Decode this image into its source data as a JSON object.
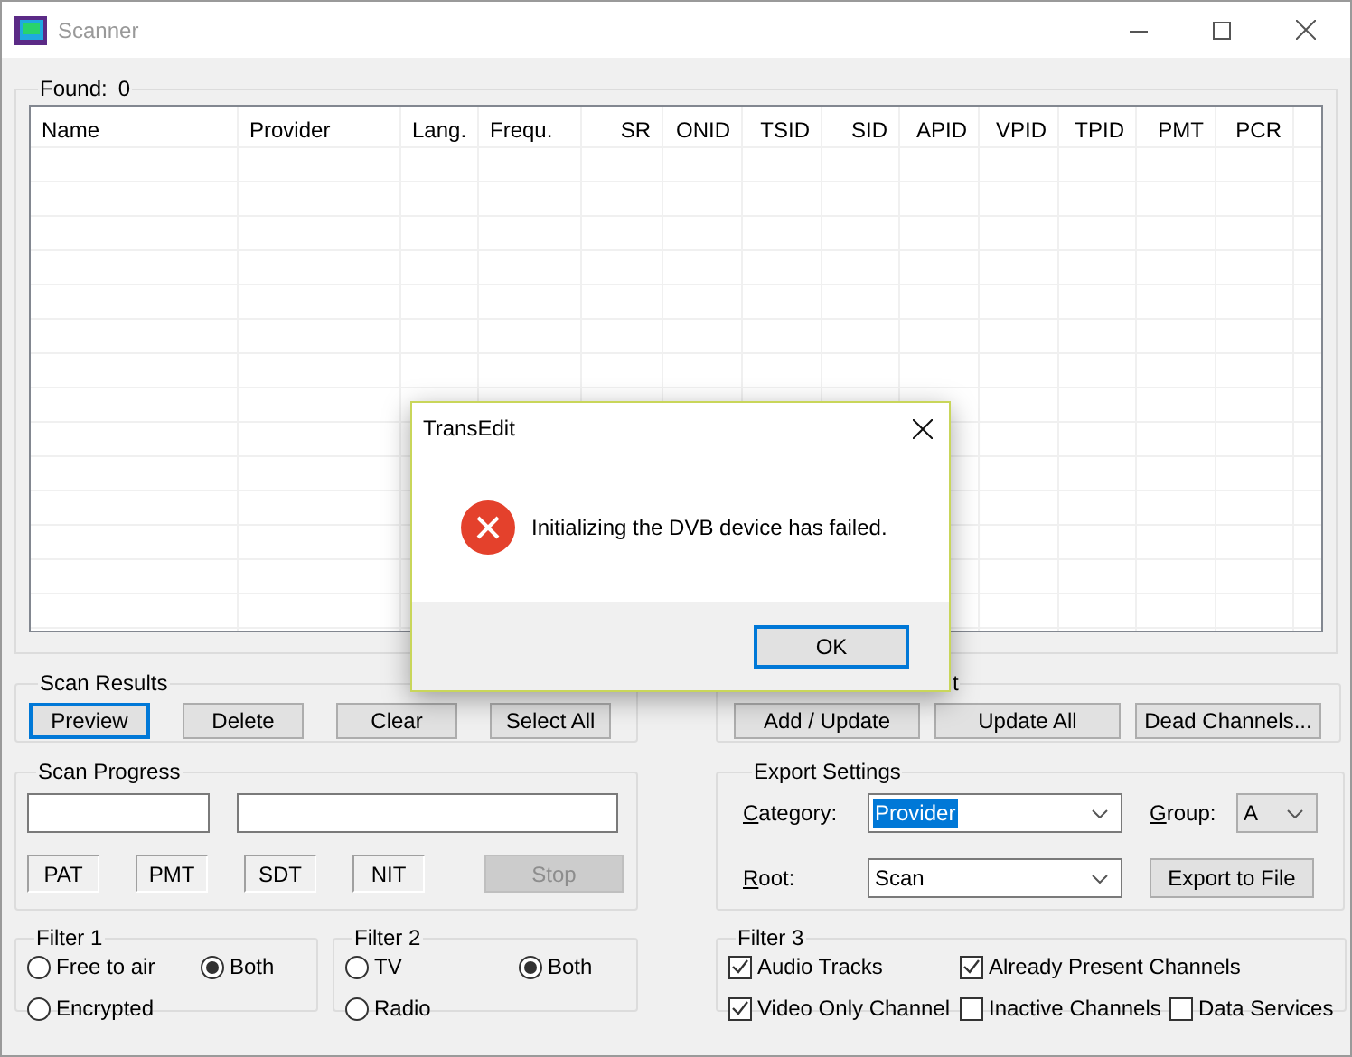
{
  "window": {
    "title": "Scanner"
  },
  "results": {
    "label": "Found:",
    "count": "0",
    "columns": [
      "Name",
      "Provider",
      "Lang.",
      "Frequ.",
      "SR",
      "ONID",
      "TSID",
      "SID",
      "APID",
      "VPID",
      "TPID",
      "PMT",
      "PCR"
    ]
  },
  "scan_results": {
    "title": "Scan Results",
    "buttons": [
      {
        "label": "Preview",
        "focused": true
      },
      {
        "label": "Delete",
        "focused": false
      },
      {
        "label": "Clear",
        "focused": false
      },
      {
        "label": "Select All",
        "focused": false
      }
    ]
  },
  "group_3": {
    "title": "t",
    "buttons": [
      {
        "label": "Add / Update",
        "focused": false
      },
      {
        "label": "Update All",
        "focused": false
      },
      {
        "label": "Dead Channels...",
        "focused": false
      }
    ]
  },
  "scan_progress": {
    "title": "Scan Progress",
    "tables": [
      "PAT",
      "PMT",
      "SDT",
      "NIT"
    ],
    "stop_button": {
      "label": "Stop",
      "disabled": true
    }
  },
  "export_settings": {
    "title": "Export Settings",
    "category": {
      "access_key": "C",
      "label_rest": "ategory:",
      "value": "Provider",
      "highlighted": true,
      "kind": "edit"
    },
    "group": {
      "access_key": "G",
      "label_rest": "roup:",
      "value": "A",
      "highlighted": false,
      "kind": "list"
    },
    "root": {
      "access_key": "R",
      "label_rest": "oot:",
      "value": "Scan",
      "highlighted": false,
      "kind": "edit"
    },
    "export_button": "Export to File"
  },
  "filter_1": {
    "title": "Filter 1",
    "options": [
      {
        "label": "Free to air",
        "selected": false
      },
      {
        "label": "Both",
        "selected": true
      },
      {
        "label": "Encrypted",
        "selected": false
      }
    ]
  },
  "filter_2": {
    "title": "Filter 2",
    "options": [
      {
        "label": "TV",
        "selected": false
      },
      {
        "label": "Both",
        "selected": true
      },
      {
        "label": "Radio",
        "selected": false
      }
    ]
  },
  "filter_3": {
    "title": "Filter 3",
    "options": [
      {
        "label": "Audio Tracks",
        "checked": true
      },
      {
        "label": "Already Present Channels",
        "checked": true
      },
      {
        "label": "Video Only Channel",
        "checked": true
      },
      {
        "label": "Inactive Channels",
        "checked": false
      },
      {
        "label": "Data Services",
        "checked": false
      }
    ]
  },
  "dialog": {
    "title": "TransEdit",
    "message": "Initializing the DVB device has failed.",
    "button": "OK"
  }
}
